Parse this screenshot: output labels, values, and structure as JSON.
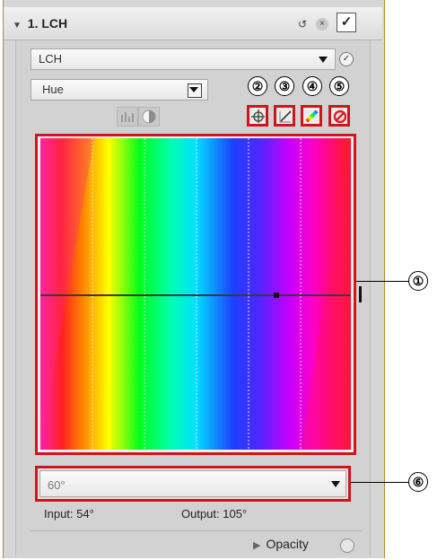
{
  "panel": {
    "title": "1. LCH",
    "collapse_glyph": "▼",
    "reset_glyph": "↺",
    "close_glyph": "×",
    "enable_glyph": "✓"
  },
  "mode_select": {
    "value": "LCH",
    "check_glyph": "✓"
  },
  "channel_select": {
    "value": "Hue"
  },
  "callouts": {
    "curve": "①",
    "add_point": "②",
    "reset_curve": "③",
    "color_picker": "④",
    "disable": "⑤",
    "range_dropdown": "⑥"
  },
  "range_dropdown": {
    "value": "60°"
  },
  "readouts": {
    "input": "Input: 54°",
    "output": "Output: 105°"
  },
  "opacity": {
    "label": "Opacity"
  },
  "icons": [
    "collapse-triangle-icon",
    "reset-icon",
    "close-icon",
    "checkbox-icon",
    "histogram-icon",
    "contrast-icon",
    "add-point-icon",
    "linear-curve-icon",
    "eyedropper-icon",
    "disable-icon",
    "play-triangle-icon"
  ],
  "colors": {
    "highlight": "#d0141b",
    "panel_border": "#b08a2a"
  }
}
